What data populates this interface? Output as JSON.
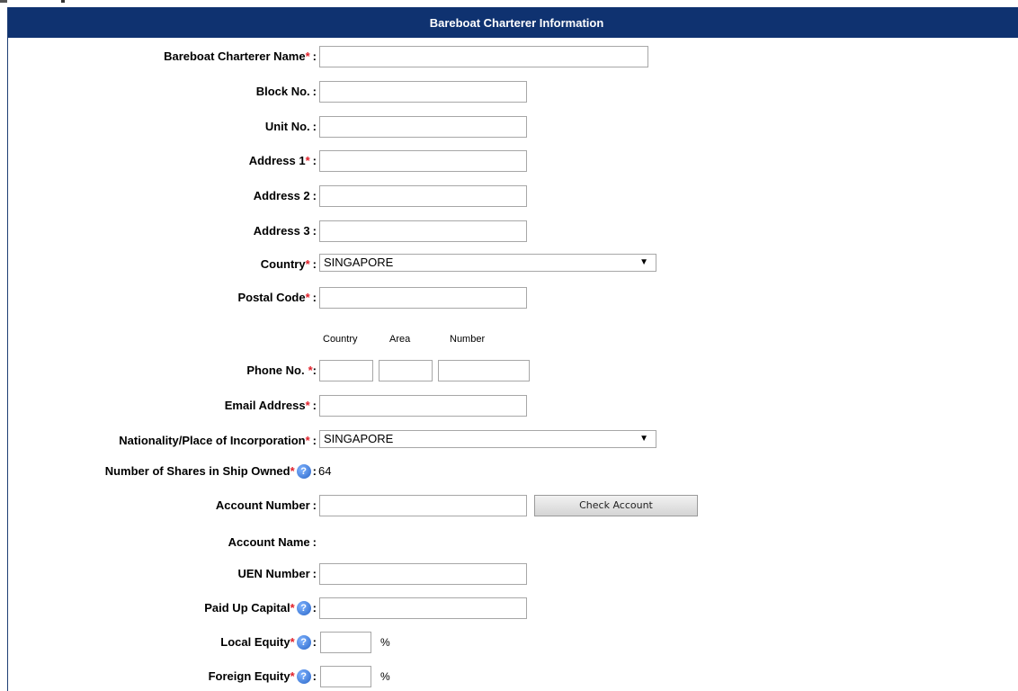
{
  "header": {
    "title": "Bareboat Charterer Information"
  },
  "fields": {
    "charterer_name": {
      "label": "Bareboat Charterer Name",
      "required": true,
      "value": ""
    },
    "block_no": {
      "label": "Block No.",
      "value": ""
    },
    "unit_no": {
      "label": "Unit No.",
      "value": ""
    },
    "address1": {
      "label": "Address 1",
      "required": true,
      "value": ""
    },
    "address2": {
      "label": "Address 2",
      "value": ""
    },
    "address3": {
      "label": "Address 3",
      "value": ""
    },
    "country": {
      "label": "Country",
      "required": true,
      "selected": "SINGAPORE"
    },
    "postal_code": {
      "label": "Postal Code",
      "required": true,
      "value": ""
    },
    "phone": {
      "label": "Phone No.",
      "required": true,
      "headers": {
        "country": "Country",
        "area": "Area",
        "number": "Number"
      }
    },
    "email": {
      "label": "Email Address",
      "required": true,
      "value": ""
    },
    "nationality": {
      "label": "Nationality/Place of Incorporation",
      "required": true,
      "selected": "SINGAPORE"
    },
    "shares": {
      "label": "Number of Shares in Ship Owned",
      "required": true,
      "value": "64"
    },
    "account_number": {
      "label": "Account Number",
      "value": "",
      "button": "Check Account"
    },
    "account_name": {
      "label": "Account Name",
      "value": ""
    },
    "uen_number": {
      "label": "UEN Number",
      "value": ""
    },
    "paid_up_capital": {
      "label": "Paid Up Capital",
      "required": true,
      "value": ""
    },
    "local_equity": {
      "label": "Local Equity",
      "required": true,
      "value": "",
      "unit": "%"
    },
    "foreign_equity": {
      "label": "Foreign Equity",
      "required": true,
      "value": "",
      "unit": "%"
    }
  },
  "symbols": {
    "required_mark": "*",
    "colon": ":",
    "help": "?",
    "dropdown_arrow": "▼"
  }
}
